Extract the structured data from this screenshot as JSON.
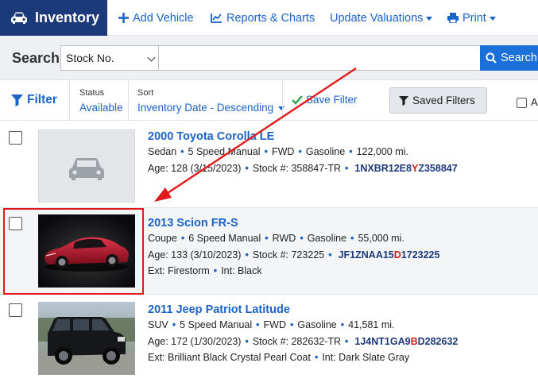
{
  "nav": {
    "brand": "Inventory",
    "add_vehicle": "Add Vehicle",
    "reports": "Reports & Charts",
    "update_valuations": "Update Valuations",
    "print": "Print",
    "brand_color": "#1c3a7a",
    "link_color": "#1b63c9"
  },
  "search": {
    "label": "Search",
    "field_selected": "Stock No.",
    "input_value": "",
    "button": "Search"
  },
  "filters": {
    "filter_label": "Filter",
    "status_label": "Status",
    "status_value": "Available",
    "sort_label": "Sort",
    "sort_value": "Inventory Date - Descending",
    "save_filter": "Save Filter",
    "saved_filters": "Saved Filters",
    "select_all_partial": "A"
  },
  "vehicles": [
    {
      "title": "2000 Toyota Corolla LE",
      "body": "Sedan",
      "transmission": "5 Speed Manual",
      "drive": "FWD",
      "fuel": "Gasoline",
      "mileage": "122,000 mi.",
      "age": "Age: 128 (3/15/2023)",
      "stock": "Stock #: 358847-TR",
      "vin_pre": "1NXBR12E8",
      "vin_hl": "Y",
      "vin_post": "Z358847",
      "colors": "",
      "image": "placeholder-car-icon"
    },
    {
      "title": "2013 Scion FR-S",
      "body": "Coupe",
      "transmission": "6 Speed Manual",
      "drive": "RWD",
      "fuel": "Gasoline",
      "mileage": "55,000 mi.",
      "age": "Age: 133 (3/10/2023)",
      "stock": "Stock #: 723225",
      "vin_pre": "JF1ZNAA15",
      "vin_hl": "D",
      "vin_post": "1723225",
      "ext": "Ext: Firestorm",
      "int": "Int: Black",
      "image": "red-sports-car-photo"
    },
    {
      "title": "2011 Jeep Patriot Latitude",
      "body": "SUV",
      "transmission": "5 Speed Manual",
      "drive": "FWD",
      "fuel": "Gasoline",
      "mileage": "41,581 mi.",
      "age": "Age: 172 (1/30/2023)",
      "stock": "Stock #: 282632-TR",
      "vin_pre": "1J4NT1GA9",
      "vin_hl": "B",
      "vin_post": "D282632",
      "ext": "Ext: Brilliant Black Crystal Pearl Coat",
      "int": "Int: Dark Slate Gray",
      "image": "black-suv-photo"
    }
  ],
  "annotation": {
    "arrow_color": "#e01b1b",
    "highlight_color": "#e01b1b"
  }
}
